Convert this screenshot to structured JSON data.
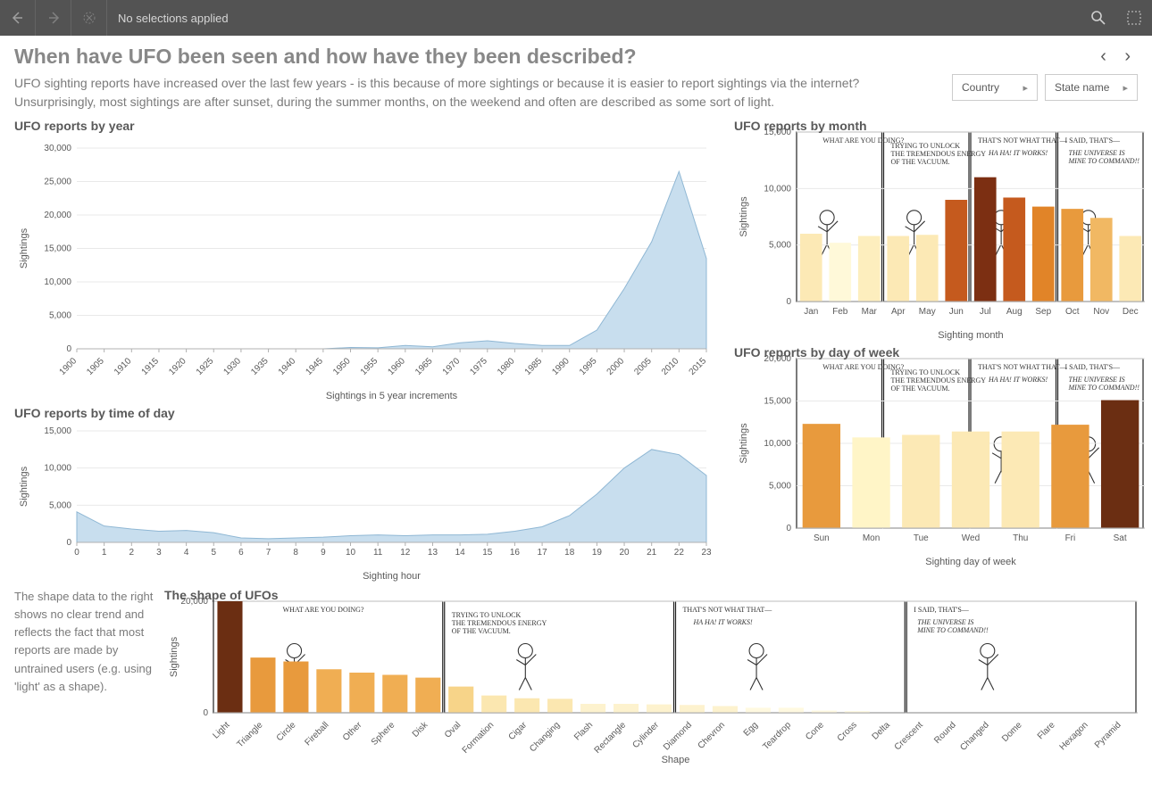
{
  "topbar": {
    "selection_text": "No selections applied"
  },
  "header": {
    "title": "When have UFO been seen and how have they been described?"
  },
  "intro": {
    "text": "UFO sighting reports have increased over the last few years - is this because of more sightings or because it is easier to report sightings via the internet? Unsurprisingly, most sightings are after sunset, during the summer months, on the weekend and often are described as some sort of light."
  },
  "filters": {
    "country": {
      "label": "Country"
    },
    "state": {
      "label": "State name"
    }
  },
  "chart_year": {
    "title": "UFO reports by year",
    "xlabel": "Sightings in 5 year increments",
    "ylabel": "Sightings"
  },
  "chart_month": {
    "title": "UFO reports by month",
    "xlabel": "Sighting month",
    "ylabel": "Sightings"
  },
  "chart_hour": {
    "title": "UFO reports by time of day",
    "xlabel": "Sighting hour",
    "ylabel": "Sightings"
  },
  "chart_dow": {
    "title": "UFO reports by day of week",
    "xlabel": "Sighting day of week",
    "ylabel": "Sightings"
  },
  "chart_shape": {
    "title": "The shape of UFOs",
    "xlabel": "Shape",
    "ylabel": "Sightings"
  },
  "shapenote": {
    "text": "The shape data to the right shows no clear trend and reflects the fact that most reports are made by untrained users (e.g. using 'light' as a shape)."
  },
  "chart_data": [
    {
      "id": "year",
      "type": "area",
      "xlabel": "Sightings in 5 year increments",
      "ylabel": "Sightings",
      "ylim": [
        0,
        30000
      ],
      "yticks": [
        0,
        5000,
        10000,
        15000,
        20000,
        25000,
        30000
      ],
      "x": [
        1900,
        1905,
        1910,
        1915,
        1920,
        1925,
        1930,
        1935,
        1940,
        1945,
        1950,
        1955,
        1960,
        1965,
        1970,
        1975,
        1980,
        1985,
        1990,
        1995,
        2000,
        2005,
        2010,
        2015
      ],
      "values": [
        0,
        0,
        0,
        0,
        0,
        0,
        0,
        0,
        0,
        0,
        200,
        150,
        500,
        300,
        900,
        1200,
        800,
        500,
        500,
        2800,
        9000,
        16000,
        26500,
        13500
      ]
    },
    {
      "id": "month",
      "type": "bar",
      "xlabel": "Sighting month",
      "ylabel": "Sightings",
      "ylim": [
        0,
        15000
      ],
      "yticks": [
        0,
        5000,
        10000,
        15000
      ],
      "categories": [
        "Jan",
        "Feb",
        "Mar",
        "Apr",
        "May",
        "Jun",
        "Jul",
        "Aug",
        "Sep",
        "Oct",
        "Nov",
        "Dec"
      ],
      "values": [
        6000,
        5200,
        5800,
        5800,
        5900,
        9000,
        11000,
        9200,
        8400,
        8200,
        7400,
        5800
      ],
      "colors": [
        "#FCE9B5",
        "#FFF9D9",
        "#FDEEBE",
        "#FCE9B5",
        "#FCE9B5",
        "#C55A1E",
        "#7C2F12",
        "#C55A1E",
        "#E18428",
        "#E89A3D",
        "#F1B863",
        "#FCE9B5"
      ]
    },
    {
      "id": "hour",
      "type": "area",
      "xlabel": "Sighting hour",
      "ylabel": "Sightings",
      "ylim": [
        0,
        15000
      ],
      "yticks": [
        0,
        5000,
        10000,
        15000
      ],
      "x": [
        0,
        1,
        2,
        3,
        4,
        5,
        6,
        7,
        8,
        9,
        10,
        11,
        12,
        13,
        14,
        15,
        16,
        17,
        18,
        19,
        20,
        21,
        22,
        23
      ],
      "values": [
        4100,
        2200,
        1800,
        1500,
        1600,
        1300,
        600,
        500,
        600,
        700,
        900,
        1000,
        900,
        1000,
        1000,
        1100,
        1500,
        2100,
        3600,
        6500,
        10000,
        12500,
        11800,
        9000
      ]
    },
    {
      "id": "dow",
      "type": "bar",
      "xlabel": "Sighting day of week",
      "ylabel": "Sightings",
      "ylim": [
        0,
        20000
      ],
      "yticks": [
        0,
        5000,
        10000,
        15000,
        20000
      ],
      "categories": [
        "Sun",
        "Mon",
        "Tue",
        "Wed",
        "Thu",
        "Fri",
        "Sat"
      ],
      "values": [
        12300,
        10700,
        11000,
        11400,
        11400,
        12200,
        15100
      ],
      "colors": [
        "#E89A3D",
        "#FFF5C7",
        "#FCE9B5",
        "#FCE9B5",
        "#FCE9B5",
        "#E89A3D",
        "#6B2E12"
      ]
    },
    {
      "id": "shape",
      "type": "bar",
      "xlabel": "Shape",
      "ylabel": "Sightings",
      "ylim": [
        0,
        20000
      ],
      "yticks": [
        0,
        20000
      ],
      "categories": [
        "Light",
        "Triangle",
        "Circle",
        "Fireball",
        "Other",
        "Sphere",
        "Disk",
        "Oval",
        "Formation",
        "Cigar",
        "Changing",
        "Flash",
        "Rectangle",
        "Cylinder",
        "Diamond",
        "Chevron",
        "Egg",
        "Teardrop",
        "Cone",
        "Cross",
        "Delta",
        "Crescent",
        "Round",
        "Changed",
        "Dome",
        "Flare",
        "Hexagon",
        "Pyramid"
      ],
      "values": [
        20000,
        9900,
        9200,
        7800,
        7200,
        6800,
        6300,
        4700,
        3100,
        2600,
        2500,
        1600,
        1600,
        1500,
        1400,
        1200,
        900,
        900,
        400,
        300,
        50,
        50,
        50,
        50,
        50,
        50,
        50,
        50
      ],
      "colors": [
        "#6B2E12",
        "#E89A3D",
        "#E89A3D",
        "#F0AE53",
        "#F0AE53",
        "#F0AE53",
        "#F0AE53",
        "#F7D489",
        "#FBE7B0",
        "#FBE7B0",
        "#FBE7B0",
        "#FDF2CE",
        "#FDF2CE",
        "#FDF2CE",
        "#FDF2CE",
        "#FDF2CE",
        "#FFF9E0",
        "#FFF9E0",
        "#FFF9E0",
        "#FFF9E0",
        "#FFFCEF",
        "#FFFCEF",
        "#FFFCEF",
        "#FFFCEF",
        "#FFFCEF",
        "#FFFCEF",
        "#FFFCEF",
        "#FFFCEF"
      ]
    }
  ],
  "comic": {
    "panels": [
      "WHAT ARE YOU DOING?",
      "TRYING TO UNLOCK THE TREMENDOUS ENERGY OF THE VACUUM.",
      "THAT'S NOT WHAT THAT—",
      "HA HA! IT WORKS!",
      "I SAID, THAT'S—",
      "THE UNIVERSE IS MINE TO COMMAND!!"
    ]
  }
}
